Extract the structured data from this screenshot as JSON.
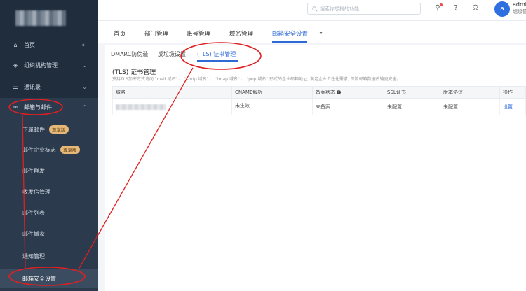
{
  "sidebar": {
    "items": [
      {
        "label": "首页",
        "icon": "home-icon",
        "right": "sidebar-collapse-icon"
      },
      {
        "label": "组织机构管理",
        "icon": "org-icon",
        "right": "chevron-down-icon"
      },
      {
        "label": "通讯录",
        "icon": "contacts-icon",
        "right": "chevron-down-icon"
      },
      {
        "label": "邮箱与邮件",
        "icon": "mail-icon",
        "right": "chevron-up-icon"
      }
    ],
    "subitems": [
      {
        "label": "下属邮件",
        "badge": "尊享版"
      },
      {
        "label": "邮件企业标志",
        "badge": "尊享版"
      },
      {
        "label": "邮件群发",
        "badge": ""
      },
      {
        "label": "收发信管理",
        "badge": ""
      },
      {
        "label": "邮件列表",
        "badge": ""
      },
      {
        "label": "邮件搬家",
        "badge": ""
      },
      {
        "label": "通知管理",
        "badge": ""
      },
      {
        "label": "邮箱安全设置",
        "badge": ""
      }
    ]
  },
  "topbar": {
    "search_placeholder": "搜索你想找的功能",
    "user_name": "admin",
    "user_role": "超级管",
    "avatar_letter": "a"
  },
  "main_tabs": [
    "首页",
    "部门管理",
    "账号管理",
    "域名管理",
    "邮箱安全设置"
  ],
  "sub_tabs": [
    "DMARC防伪造",
    "反垃圾设置",
    "(TLS) 证书管理"
  ],
  "section": {
    "title": "(TLS) 证书管理",
    "desc": "支持TLS加密方式访问 \"mail.域名\" 、 \"smtp.域名\" 、 \"imap.域名\" 、 \"pop.域名\" 形式的企业邮箱地址, 满足企业个性化需求, 保障邮箱数据传输更安全。"
  },
  "table": {
    "headers": [
      "域名",
      "CNAME解析",
      "备案状态",
      "SSL证书",
      "版本协议",
      "操作"
    ],
    "rows": [
      {
        "cname": "未生效",
        "beian": "未备案",
        "ssl": "未配置",
        "version": "未配置",
        "action": "设置"
      }
    ]
  },
  "colors": {
    "accent": "#2d6ad6",
    "sidebar_bg": "#1f2d3d",
    "annotation": "#e02020"
  }
}
